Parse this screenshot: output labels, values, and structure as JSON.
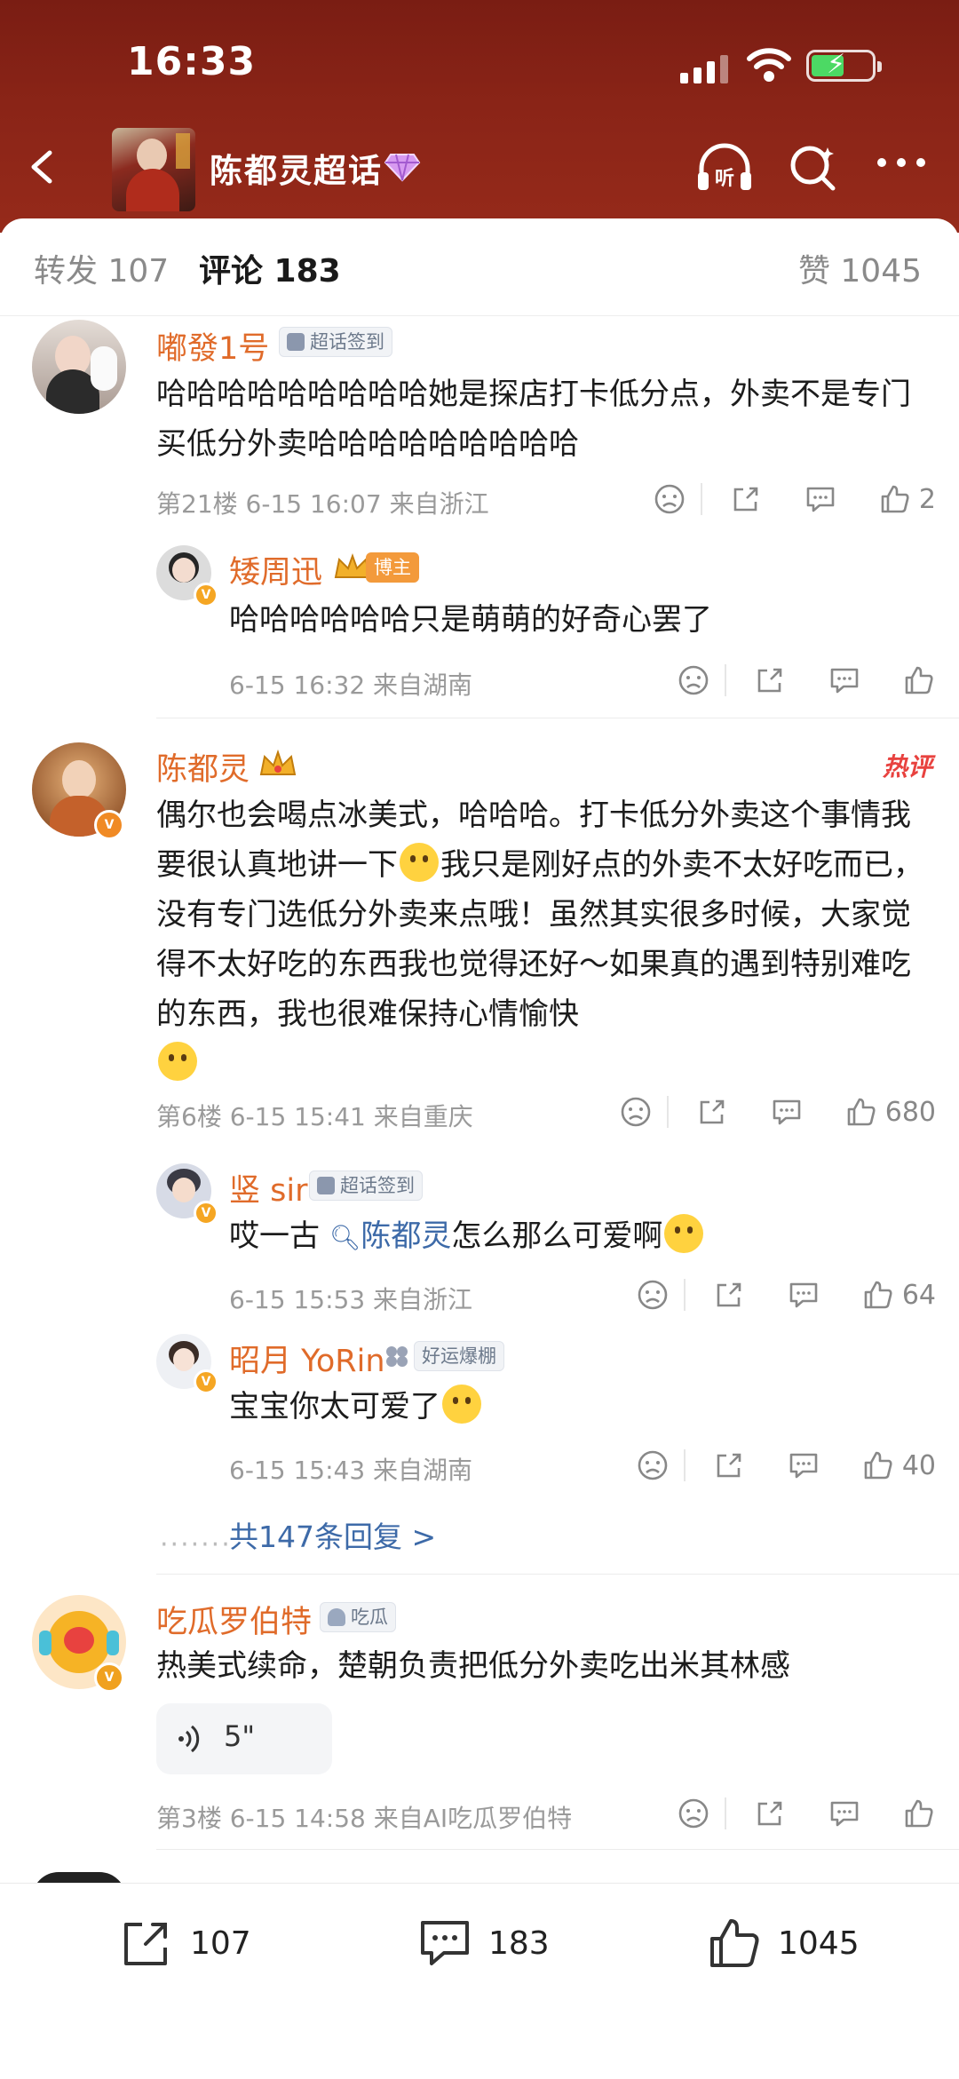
{
  "status_bar": {
    "time": "16:33"
  },
  "header": {
    "title": "陈都灵超话"
  },
  "tabs": {
    "repost": "转发 107",
    "comments": "评论 183",
    "likes": "赞 1045"
  },
  "comments": [
    {
      "user": "嘟發1号",
      "tag": "超话签到",
      "text": "哈哈哈哈哈哈哈哈哈她是探店打卡低分点，外卖不是专门买低分外卖哈哈哈哈哈哈哈哈哈",
      "meta": "第21楼 6-15 16:07 来自浙江",
      "likes": "2",
      "replies": [
        {
          "user": "矮周迅",
          "tag": "博主",
          "text": "哈哈哈哈哈哈只是萌萌的好奇心罢了",
          "meta": "6-15 16:32 来自湖南",
          "likes": ""
        }
      ]
    },
    {
      "user": "陈都灵",
      "hot": "热评",
      "text_parts": [
        "偶尔也会喝点冰美式，哈哈哈。打卡低分外卖这个事情我要很认真地讲一下",
        "我只是刚好点的外卖不太好吃而已，没有专门选低分外卖来点哦！虽然其实很多时候，大家觉得不太好吃的东西我也觉得还好～如果真的遇到特别难吃的东西，我也很难保持心情愉快"
      ],
      "meta": "第6楼 6-15 15:41 来自重庆",
      "likes": "680",
      "replies": [
        {
          "user": "竖 sir",
          "tag": "超话签到",
          "text_pre": "哎一古 ",
          "topic": "陈都灵",
          "text_post": "怎么那么可爱啊",
          "meta": "6-15 15:53 来自浙江",
          "likes": "64"
        },
        {
          "user": "昭月 YoRin",
          "tag": "好运爆棚",
          "text": "宝宝你太可爱了",
          "meta": "6-15 15:43 来自湖南",
          "likes": "40"
        }
      ],
      "more_replies": "共147条回复 >"
    },
    {
      "user": "吃瓜罗伯特",
      "tag": "吃瓜",
      "text": "热美式续命，楚朝负责把低分外卖吃出米其林感",
      "voice": "5\"",
      "meta": "第3楼 6-15 14:58 来自AI吃瓜罗伯特",
      "likes": ""
    }
  ],
  "bottom_bar": {
    "repost": "107",
    "comment": "183",
    "like": "1045"
  }
}
